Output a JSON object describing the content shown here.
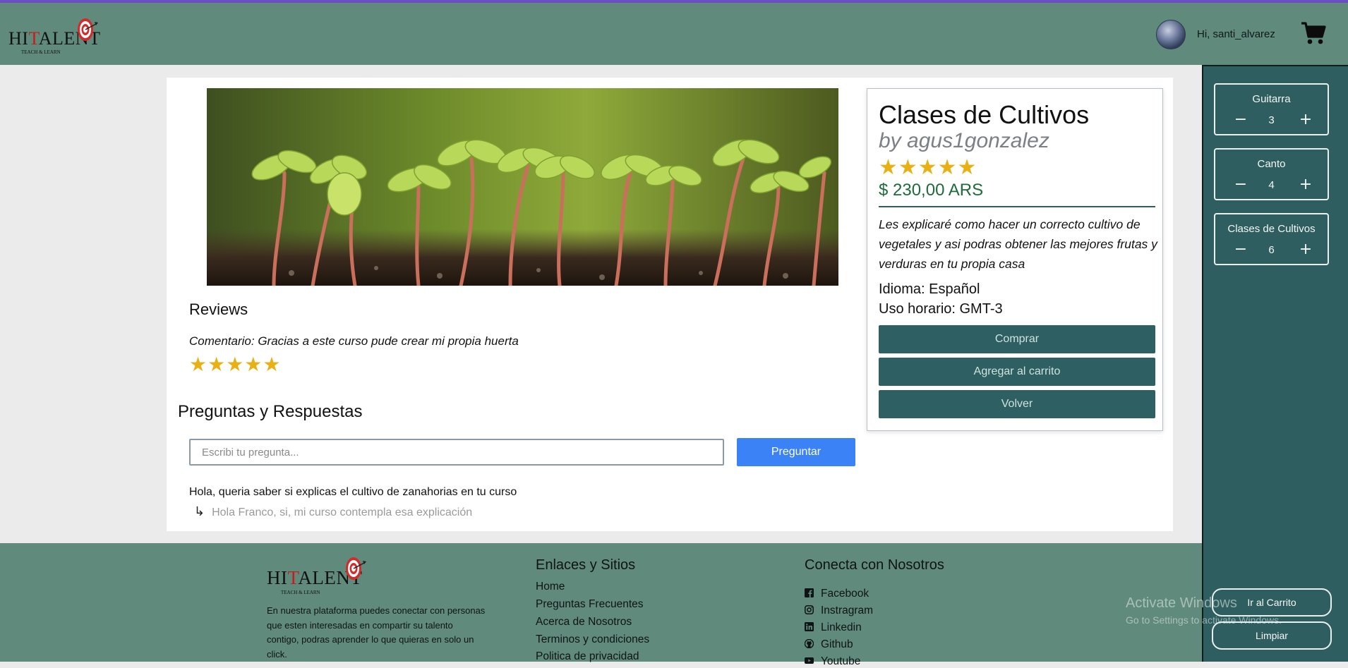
{
  "header": {
    "logo": {
      "word_pre": "HI",
      "word_t": "T",
      "word_post": "ALENT",
      "tagline": "TEACH & LEARN"
    },
    "greeting": "Hi, santi_alvarez",
    "icons": {
      "avatar": "user-avatar",
      "cart": "shopping-cart-icon"
    }
  },
  "reviews": {
    "title": "Reviews",
    "comment": "Comentario: Gracias a este curso pude crear mi propia huerta",
    "stars": "★★★★★",
    "rating": 5
  },
  "qa": {
    "title": "Preguntas y Respuestas",
    "input_placeholder": "Escribi tu pregunta...",
    "ask_label": "Preguntar",
    "question": "Hola, queria saber si explicas el cultivo de zanahorias en tu curso",
    "answer_arrow": "↳",
    "answer": "Hola Franco, si, mi curso contempla esa explicación"
  },
  "course": {
    "title": "Clases de Cultivos",
    "by": "by agus1gonzalez",
    "stars": "★★★★★",
    "rating": 5,
    "price": "$ 230,00 ARS",
    "description": "Les explicaré como hacer un correcto cultivo de vegetales y asi podras obtener las mejores frutas y verduras en tu propia casa",
    "language": "Idioma: Español",
    "timezone": "Uso horario: GMT-3",
    "buy_label": "Comprar",
    "add_cart_label": "Agregar al carrito",
    "back_label": "Volver"
  },
  "cart": {
    "items": [
      {
        "name": "Guitarra",
        "qty": "3",
        "minus": "−",
        "plus": "+"
      },
      {
        "name": "Canto",
        "qty": "4",
        "minus": "−",
        "plus": "+"
      },
      {
        "name": "Clases de Cultivos",
        "qty": "6",
        "minus": "−",
        "plus": "+"
      }
    ],
    "go_cart_label": "Ir al Carrito",
    "clear_label": "Limpiar"
  },
  "footer": {
    "about": "En nuestra plataforma puedes conectar con personas que esten interesadas en compartir su talento contigo, podras aprender lo que quieras en solo un click.",
    "links_title": "Enlaces y Sitios",
    "links": [
      "Home",
      "Preguntas Frecuentes",
      "Acerca de Nosotros",
      "Terminos y condiciones",
      "Politica de privacidad"
    ],
    "social_title": "Conecta con Nosotros",
    "social": [
      {
        "label": "Facebook",
        "icon": "facebook-icon"
      },
      {
        "label": "Instragram",
        "icon": "instagram-icon"
      },
      {
        "label": "Linkedin",
        "icon": "linkedin-icon"
      },
      {
        "label": "Github",
        "icon": "github-icon"
      },
      {
        "label": "Youtube",
        "icon": "youtube-icon"
      }
    ]
  },
  "os_watermark": {
    "line1": "Activate Windows",
    "line2": "Go to Settings to activate Windows."
  },
  "colors": {
    "navbar": "#5f8a7c",
    "sidecart": "#2f5e60",
    "button_dark": "#2e5f62",
    "ask_button": "#3b82f6",
    "star": "#e8b013",
    "price": "#1e6b3c"
  }
}
